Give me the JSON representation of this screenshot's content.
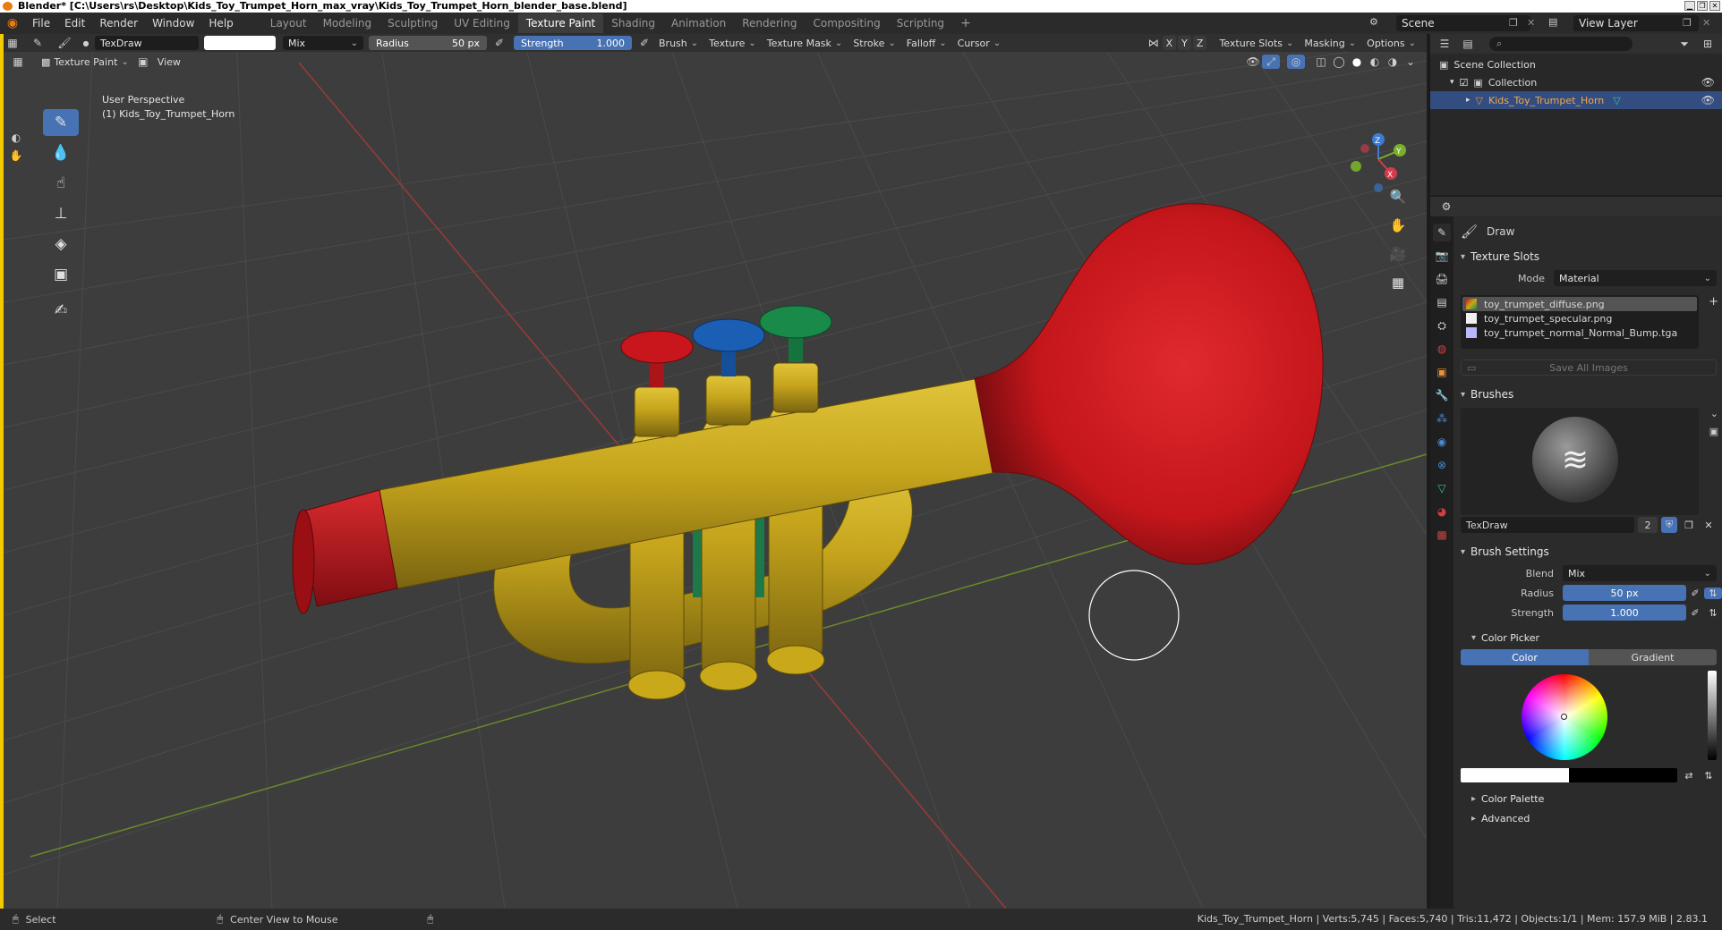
{
  "window": {
    "title": "Blender* [C:\\Users\\rs\\Desktop\\Kids_Toy_Trumpet_Horn_max_vray\\Kids_Toy_Trumpet_Horn_blender_base.blend]",
    "controls": [
      "▁",
      "❐",
      "✕"
    ]
  },
  "menu": [
    "File",
    "Edit",
    "Render",
    "Window",
    "Help"
  ],
  "workspaces": [
    "Layout",
    "Modeling",
    "Sculpting",
    "UV Editing",
    "Texture Paint",
    "Shading",
    "Animation",
    "Rendering",
    "Compositing",
    "Scripting"
  ],
  "workspace_add": "+",
  "scene": {
    "name": "Scene",
    "view_layer": "View Layer"
  },
  "tool_header": {
    "brush_name": "TexDraw",
    "blend_mode": "Mix",
    "radius_label": "Radius",
    "radius_value": "50 px",
    "strength_label": "Strength",
    "strength_value": "1.000",
    "menus": [
      "Brush",
      "Texture",
      "Texture Mask",
      "Stroke",
      "Falloff",
      "Cursor"
    ],
    "axes": [
      "X",
      "Y",
      "Z"
    ],
    "right_menus": [
      "Texture Slots",
      "Masking",
      "Options"
    ]
  },
  "viewport_header": {
    "mode": "Texture Paint",
    "view_menu": "View"
  },
  "viewport_info": {
    "perspective": "User Perspective",
    "object": "(1) Kids_Toy_Trumpet_Horn"
  },
  "gizmo_axes": [
    "Z",
    "Y",
    "X"
  ],
  "outliner": {
    "root": "Scene Collection",
    "collection": "Collection",
    "object": "Kids_Toy_Trumpet_Horn"
  },
  "properties": {
    "tool_name": "Draw",
    "texture_slots_title": "Texture Slots",
    "mode_label": "Mode",
    "mode_value": "Material",
    "slots": [
      "toy_trumpet_diffuse.png",
      "toy_trumpet_specular.png",
      "toy_trumpet_normal_Normal_Bump.tga"
    ],
    "save_all": "Save All Images",
    "brushes_title": "Brushes",
    "brush_name": "TexDraw",
    "brush_users": "2",
    "brush_settings_title": "Brush Settings",
    "blend_label": "Blend",
    "blend_value": "Mix",
    "radius_label": "Radius",
    "radius_value": "50 px",
    "strength_label": "Strength",
    "strength_value": "1.000",
    "color_picker_title": "Color Picker",
    "color_tab": "Color",
    "gradient_tab": "Gradient",
    "color_palette_title": "Color Palette",
    "advanced_title": "Advanced"
  },
  "statusbar": {
    "select": "Select",
    "center_view": "Center View to Mouse",
    "stats": "Kids_Toy_Trumpet_Horn | Verts:5,745 | Faces:5,740 | Tris:11,472 | Objects:1/1 | Mem: 157.9 MiB | 2.83.1"
  },
  "colors": {
    "accent": "#4772b3",
    "trumpet_gold": "#c9a91a",
    "trumpet_red": "#c8161c",
    "valve_blue": "#1a5fb4",
    "valve_green": "#1a8a4a",
    "active_color": "#ffffff",
    "secondary_color": "#000000"
  }
}
